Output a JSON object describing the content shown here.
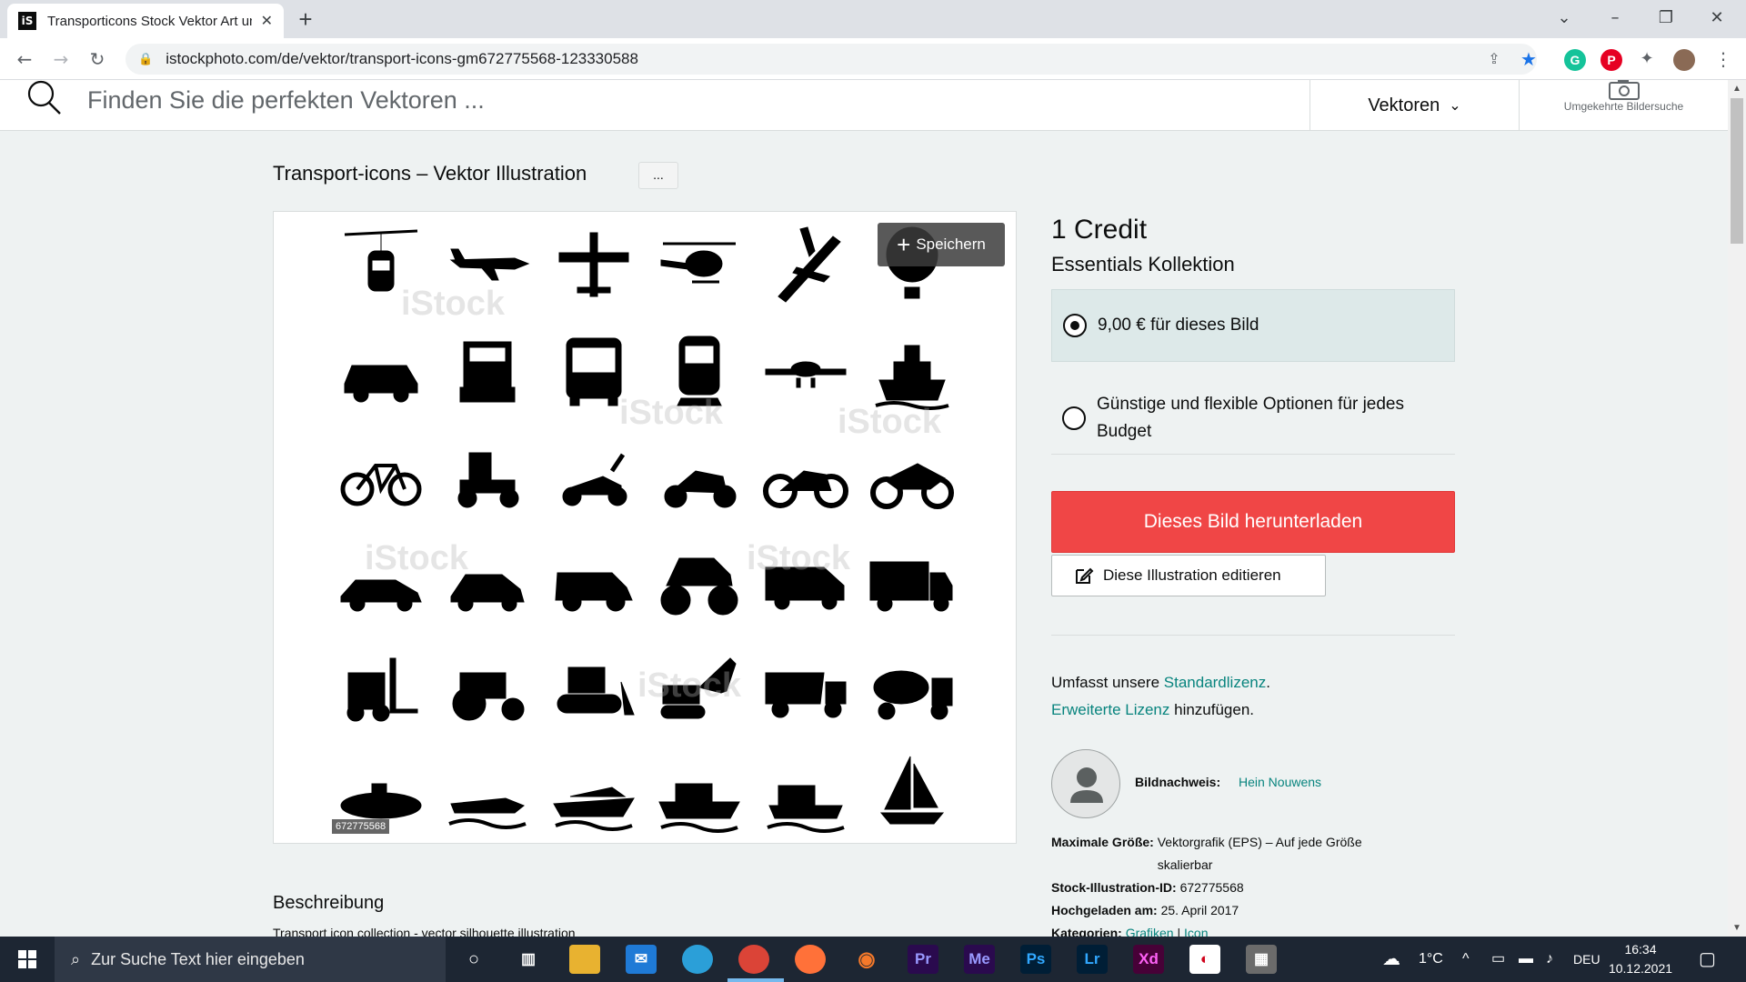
{
  "browser": {
    "tab_title": "Transporticons Stock Vektor Art und mehr",
    "favicon_text": "iS",
    "url": "istockphoto.com/de/vektor/transport-icons-gm672775568-123330588"
  },
  "header": {
    "search_placeholder": "Finden Sie die perfekten Vektoren ...",
    "media_type": "Vektoren",
    "reverse_search_label": "Umgekehrte Bildersuche"
  },
  "asset": {
    "title": "Transport-icons – Vektor Illustration",
    "more_label": "...",
    "save_label": "Speichern",
    "image_id_badge": "672775568",
    "watermark": "iStock",
    "description_heading": "Beschreibung",
    "description_text": "Transport icon collection - vector silhouette illustration",
    "icons": [
      "cable-car",
      "propeller-plane",
      "small-plane",
      "helicopter",
      "jet-plane",
      "hot-air-balloon",
      "car",
      "truck",
      "bus",
      "train",
      "airliner",
      "ship",
      "bicycle",
      "mobility-scooter",
      "scooter",
      "motor-scooter",
      "dirt-bike",
      "sport-motorcycle",
      "sedan",
      "hatchback",
      "suv",
      "monster-truck",
      "van",
      "lorry",
      "forklift",
      "tractor",
      "bulldozer",
      "excavator",
      "dump-truck",
      "cement-mixer",
      "submarine",
      "jet-ski",
      "yacht",
      "ferry",
      "hovercraft",
      "sailboat"
    ]
  },
  "pricing": {
    "credit": "1 Credit",
    "collection": "Essentials Kollektion",
    "option1": "9,00 € für dieses Bild",
    "option2_bold": "Günstige",
    "option2_rest": "und flexible Optionen für jedes Budget",
    "download_label": "Dieses Bild herunterladen",
    "edit_label": "Diese Illustration editieren"
  },
  "license": {
    "prefix": "Umfasst unsere ",
    "standard_link": "Standardlizenz",
    "suffix1": ".",
    "extended_link": "Erweiterte Lizenz",
    "suffix2": " hinzufügen."
  },
  "details": {
    "credit_label": "Bildnachweis:",
    "credit_name": "Hein Nouwens",
    "max_size_label": "Maximale Größe:",
    "max_size_value": "Vektorgrafik (EPS) – Auf jede Größe skalierbar",
    "id_label": "Stock-Illustration-ID:",
    "id_value": "672775568",
    "uploaded_label": "Hochgeladen am:",
    "uploaded_value": "25. April 2017",
    "categories_label": "Kategorien:",
    "categories_1": "Grafiken",
    "categories_sep": " | ",
    "categories_2": "Icon"
  },
  "taskbar": {
    "search_placeholder": "Zur Suche Text hier eingeben",
    "temperature": "1°C",
    "language": "DEU",
    "time": "16:34",
    "date": "10.12.2021",
    "apps": [
      "Pr",
      "Me",
      "Ps",
      "Lr",
      "Xd"
    ]
  },
  "colors": {
    "accent": "#08847e",
    "download": "#f04646",
    "selected_option_bg": "#dde9e9"
  }
}
